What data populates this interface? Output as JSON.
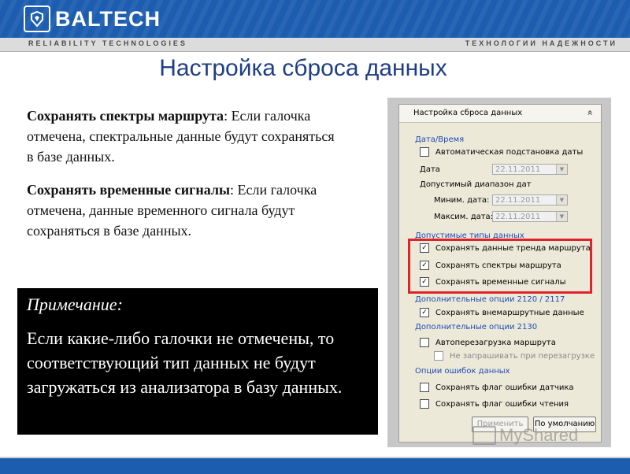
{
  "header": {
    "brand": "BALTECH",
    "tagline_left": "RELIABILITY  TECHNOLOGIES",
    "tagline_right": "ТЕХНОЛОГИИ НАДЕЖНОСТИ"
  },
  "slide": {
    "title": "Настройка сброса данных",
    "p1_bold": "Сохранять спектры маршрута",
    "p1_rest": ": Если галочка отмечена, спектральные данные будут сохраняться в базе данных.",
    "p2_bold": "Сохранять временные сигналы",
    "p2_rest": ": Если галочка отмечена, данные временного сигнала будут сохраняться в базе данных.",
    "note_title": "Примечание:",
    "note_body": "Если какие-либо  галочки не отмечены, то  соответствующий тип данных не будут загружаться из анализатора в базу данных."
  },
  "dialog": {
    "title": "Настройка сброса данных",
    "collapse_glyph": "«",
    "group_datetime": "Дата/Время",
    "auto_date": "Автоматическая подстановка даты",
    "date_label": "Дата",
    "date_value": "22.11.2011",
    "range_label": "Допустимый диапазон дат",
    "min_label": "Миним. дата:",
    "min_value": "22.11.2011",
    "max_label": "Максим. дата:",
    "max_value": "22.11.2011",
    "group_types": "Допустимые типы данных",
    "save_trend": "Сохранять данные тренда маршрута",
    "save_spectra": "Сохранять спектры маршрута",
    "save_signals": "Сохранять временные сигналы",
    "group_2120": "Дополнительные опции 2120 / 2117",
    "save_offroute": "Сохранять внемаршрутные данные",
    "group_2130": "Дополнительные опции 2130",
    "auto_reload": "Автоперезагрузка маршрута",
    "no_ask": "Не запрашивать при перезагрузке",
    "group_errors": "Опции ошибок данных",
    "sensor_error": "Сохранять флаг ошибки датчика",
    "read_error": "Сохранять флаг ошибки чтения",
    "apply": "Применить",
    "default": "По умолчанию",
    "check": "✓",
    "arrow": "▼"
  },
  "watermark": "MyShared",
  "colors": {
    "header_blue": "#1c5db0",
    "title_blue": "#1f3f84",
    "highlight_red": "#e0232b",
    "group_blue": "#1c4bb8"
  }
}
